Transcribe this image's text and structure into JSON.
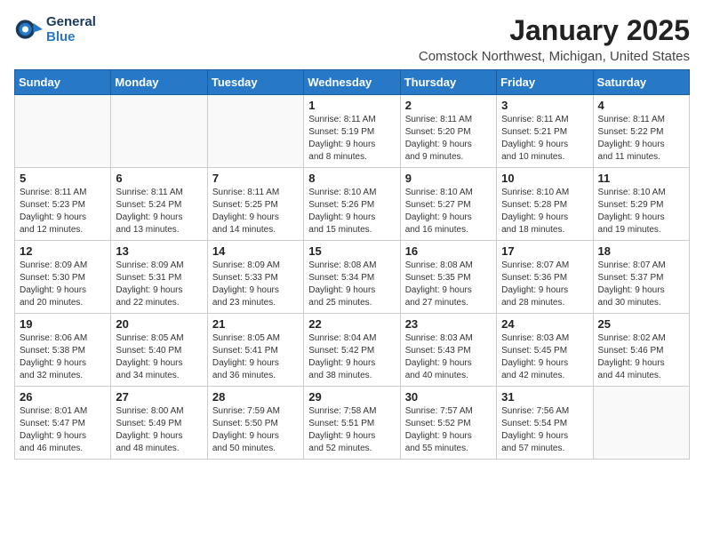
{
  "header": {
    "logo_line1": "General",
    "logo_line2": "Blue",
    "month": "January 2025",
    "location": "Comstock Northwest, Michigan, United States"
  },
  "weekdays": [
    "Sunday",
    "Monday",
    "Tuesday",
    "Wednesday",
    "Thursday",
    "Friday",
    "Saturday"
  ],
  "weeks": [
    [
      {
        "day": "",
        "info": ""
      },
      {
        "day": "",
        "info": ""
      },
      {
        "day": "",
        "info": ""
      },
      {
        "day": "1",
        "info": "Sunrise: 8:11 AM\nSunset: 5:19 PM\nDaylight: 9 hours\nand 8 minutes."
      },
      {
        "day": "2",
        "info": "Sunrise: 8:11 AM\nSunset: 5:20 PM\nDaylight: 9 hours\nand 9 minutes."
      },
      {
        "day": "3",
        "info": "Sunrise: 8:11 AM\nSunset: 5:21 PM\nDaylight: 9 hours\nand 10 minutes."
      },
      {
        "day": "4",
        "info": "Sunrise: 8:11 AM\nSunset: 5:22 PM\nDaylight: 9 hours\nand 11 minutes."
      }
    ],
    [
      {
        "day": "5",
        "info": "Sunrise: 8:11 AM\nSunset: 5:23 PM\nDaylight: 9 hours\nand 12 minutes."
      },
      {
        "day": "6",
        "info": "Sunrise: 8:11 AM\nSunset: 5:24 PM\nDaylight: 9 hours\nand 13 minutes."
      },
      {
        "day": "7",
        "info": "Sunrise: 8:11 AM\nSunset: 5:25 PM\nDaylight: 9 hours\nand 14 minutes."
      },
      {
        "day": "8",
        "info": "Sunrise: 8:10 AM\nSunset: 5:26 PM\nDaylight: 9 hours\nand 15 minutes."
      },
      {
        "day": "9",
        "info": "Sunrise: 8:10 AM\nSunset: 5:27 PM\nDaylight: 9 hours\nand 16 minutes."
      },
      {
        "day": "10",
        "info": "Sunrise: 8:10 AM\nSunset: 5:28 PM\nDaylight: 9 hours\nand 18 minutes."
      },
      {
        "day": "11",
        "info": "Sunrise: 8:10 AM\nSunset: 5:29 PM\nDaylight: 9 hours\nand 19 minutes."
      }
    ],
    [
      {
        "day": "12",
        "info": "Sunrise: 8:09 AM\nSunset: 5:30 PM\nDaylight: 9 hours\nand 20 minutes."
      },
      {
        "day": "13",
        "info": "Sunrise: 8:09 AM\nSunset: 5:31 PM\nDaylight: 9 hours\nand 22 minutes."
      },
      {
        "day": "14",
        "info": "Sunrise: 8:09 AM\nSunset: 5:33 PM\nDaylight: 9 hours\nand 23 minutes."
      },
      {
        "day": "15",
        "info": "Sunrise: 8:08 AM\nSunset: 5:34 PM\nDaylight: 9 hours\nand 25 minutes."
      },
      {
        "day": "16",
        "info": "Sunrise: 8:08 AM\nSunset: 5:35 PM\nDaylight: 9 hours\nand 27 minutes."
      },
      {
        "day": "17",
        "info": "Sunrise: 8:07 AM\nSunset: 5:36 PM\nDaylight: 9 hours\nand 28 minutes."
      },
      {
        "day": "18",
        "info": "Sunrise: 8:07 AM\nSunset: 5:37 PM\nDaylight: 9 hours\nand 30 minutes."
      }
    ],
    [
      {
        "day": "19",
        "info": "Sunrise: 8:06 AM\nSunset: 5:38 PM\nDaylight: 9 hours\nand 32 minutes."
      },
      {
        "day": "20",
        "info": "Sunrise: 8:05 AM\nSunset: 5:40 PM\nDaylight: 9 hours\nand 34 minutes."
      },
      {
        "day": "21",
        "info": "Sunrise: 8:05 AM\nSunset: 5:41 PM\nDaylight: 9 hours\nand 36 minutes."
      },
      {
        "day": "22",
        "info": "Sunrise: 8:04 AM\nSunset: 5:42 PM\nDaylight: 9 hours\nand 38 minutes."
      },
      {
        "day": "23",
        "info": "Sunrise: 8:03 AM\nSunset: 5:43 PM\nDaylight: 9 hours\nand 40 minutes."
      },
      {
        "day": "24",
        "info": "Sunrise: 8:03 AM\nSunset: 5:45 PM\nDaylight: 9 hours\nand 42 minutes."
      },
      {
        "day": "25",
        "info": "Sunrise: 8:02 AM\nSunset: 5:46 PM\nDaylight: 9 hours\nand 44 minutes."
      }
    ],
    [
      {
        "day": "26",
        "info": "Sunrise: 8:01 AM\nSunset: 5:47 PM\nDaylight: 9 hours\nand 46 minutes."
      },
      {
        "day": "27",
        "info": "Sunrise: 8:00 AM\nSunset: 5:49 PM\nDaylight: 9 hours\nand 48 minutes."
      },
      {
        "day": "28",
        "info": "Sunrise: 7:59 AM\nSunset: 5:50 PM\nDaylight: 9 hours\nand 50 minutes."
      },
      {
        "day": "29",
        "info": "Sunrise: 7:58 AM\nSunset: 5:51 PM\nDaylight: 9 hours\nand 52 minutes."
      },
      {
        "day": "30",
        "info": "Sunrise: 7:57 AM\nSunset: 5:52 PM\nDaylight: 9 hours\nand 55 minutes."
      },
      {
        "day": "31",
        "info": "Sunrise: 7:56 AM\nSunset: 5:54 PM\nDaylight: 9 hours\nand 57 minutes."
      },
      {
        "day": "",
        "info": ""
      }
    ]
  ]
}
